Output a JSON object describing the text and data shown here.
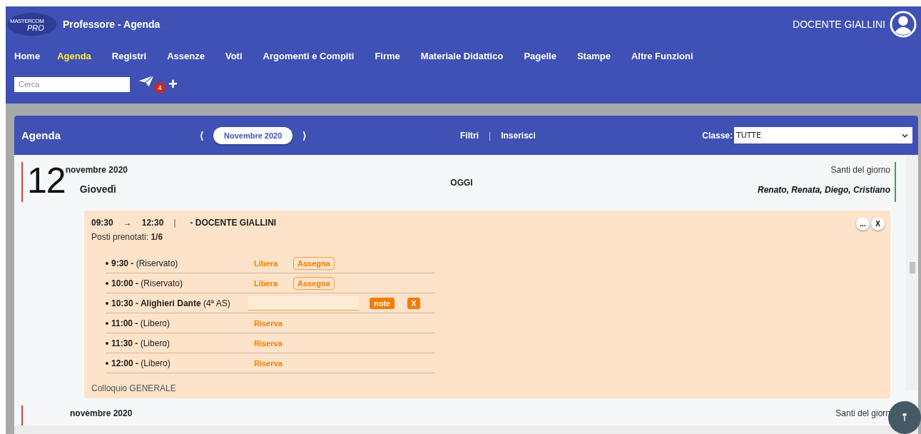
{
  "header": {
    "logo": {
      "top": "MASTERCOM",
      "bottom": "PRO"
    },
    "title": "Professore - Agenda",
    "user": "DOCENTE GIALLINI"
  },
  "nav": [
    {
      "label": "Home",
      "selected": false
    },
    {
      "label": "Agenda",
      "selected": true
    },
    {
      "label": "Registri",
      "selected": false
    },
    {
      "label": "Assenze",
      "selected": false
    },
    {
      "label": "Voti",
      "selected": false
    },
    {
      "label": "Argomenti e Compiti",
      "selected": false
    },
    {
      "label": "Firme",
      "selected": false
    },
    {
      "label": "Materiale Didattico",
      "selected": false
    },
    {
      "label": "Pagelle",
      "selected": false
    },
    {
      "label": "Stampe",
      "selected": false
    },
    {
      "label": "Altre Funzioni",
      "selected": false
    }
  ],
  "search": {
    "placeholder": "Cerca"
  },
  "messages_badge": "4",
  "add_button": "+",
  "panel": {
    "title": "Agenda",
    "prev": "⟨",
    "month": "Novembre 2020",
    "next": "⟩",
    "filters": "Filtri",
    "separator": "|",
    "insert": "Inserisci",
    "class_label": "Classe:",
    "class_value": "TUTTE"
  },
  "days": [
    {
      "day": "12",
      "month": "novembre 2020",
      "weekday": "Giovedì",
      "today": "OGGI",
      "saints_label": "Santi del giorno",
      "saints": "Renato, Renata, Diego, Cristiano",
      "event": {
        "start": "09:30",
        "arrow": "→",
        "end": "12:30",
        "separator": "|",
        "teacher": "- DOCENTE GIALLINI",
        "booked": "Posti prenotati: **1/6**",
        "more_button": "...",
        "close_button": "X",
        "slots": [
          {
            "kind": "reserved",
            "time": "9:30 -",
            "label": "(Riservato)",
            "action": "Libera",
            "button": "Assegna"
          },
          {
            "kind": "reserved",
            "time": "10:00 -",
            "label": "(Riservato)",
            "action": "Libera",
            "button": "Assegna"
          },
          {
            "kind": "booked",
            "time": "10:30 - Alighieri Dante",
            "label": "(4ª AS)",
            "note_button": "note",
            "remove_button": "X"
          },
          {
            "kind": "free",
            "time": "11:00 -",
            "label": "(Libero)",
            "action": "Riserva"
          },
          {
            "kind": "free",
            "time": "11:30 -",
            "label": "(Libero)",
            "action": "Riserva"
          },
          {
            "kind": "free",
            "time": "12:00 -",
            "label": "(Libero)",
            "action": "Riserva"
          }
        ],
        "footer": "Colloquio GENERALE"
      }
    },
    {
      "month": "novembre 2020",
      "saints_label": "Santi del giorn"
    }
  ]
}
